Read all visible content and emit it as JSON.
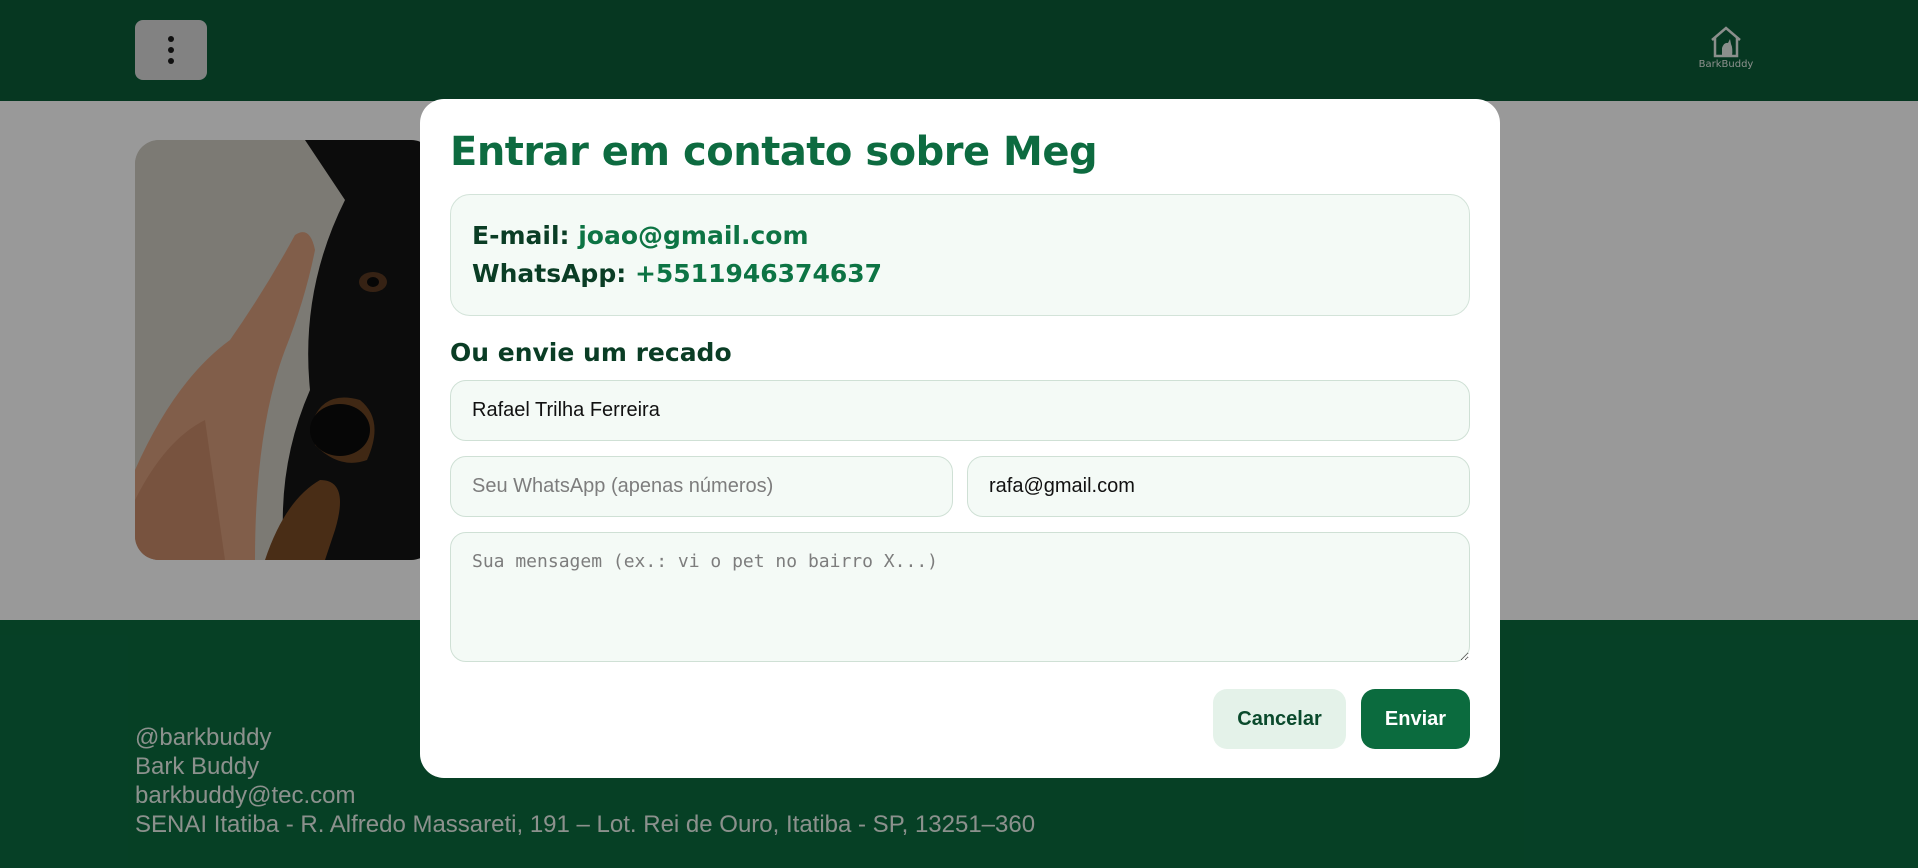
{
  "header": {
    "menu_icon": "kebab-menu-icon",
    "logo_text": "BarkBuddy",
    "logo_icon": "dog-house-icon"
  },
  "main": {
    "pet_photo_alt": "Meg"
  },
  "footer": {
    "lines": [
      "@barkbuddy",
      "Bark Buddy",
      "barkbuddy@tec.com",
      "SENAI Itatiba - R. Alfredo Massareti, 191 – Lot. Rei de Ouro, Itatiba - SP, 13251–360"
    ]
  },
  "modal": {
    "title": "Entrar em contato sobre Meg",
    "email_label": "E-mail:",
    "email_value": "joao@gmail.com",
    "whatsapp_label": "WhatsApp:",
    "whatsapp_value": "+5511946374637",
    "section_title": "Ou envie um recado",
    "name_value": "Rafael Trilha Ferreira",
    "whatsapp_placeholder": "Seu WhatsApp (apenas números)",
    "whatsapp_input_value": "",
    "email_input_value": "rafa@gmail.com",
    "message_placeholder": "Sua mensagem (ex.: vi o pet no bairro X...)",
    "cancel_label": "Cancelar",
    "send_label": "Enviar"
  },
  "colors": {
    "header_bg": "#0a5c38",
    "footer_bg": "#0a6b3f",
    "accent": "#0d6b40",
    "field_bg": "#f4faf6"
  }
}
